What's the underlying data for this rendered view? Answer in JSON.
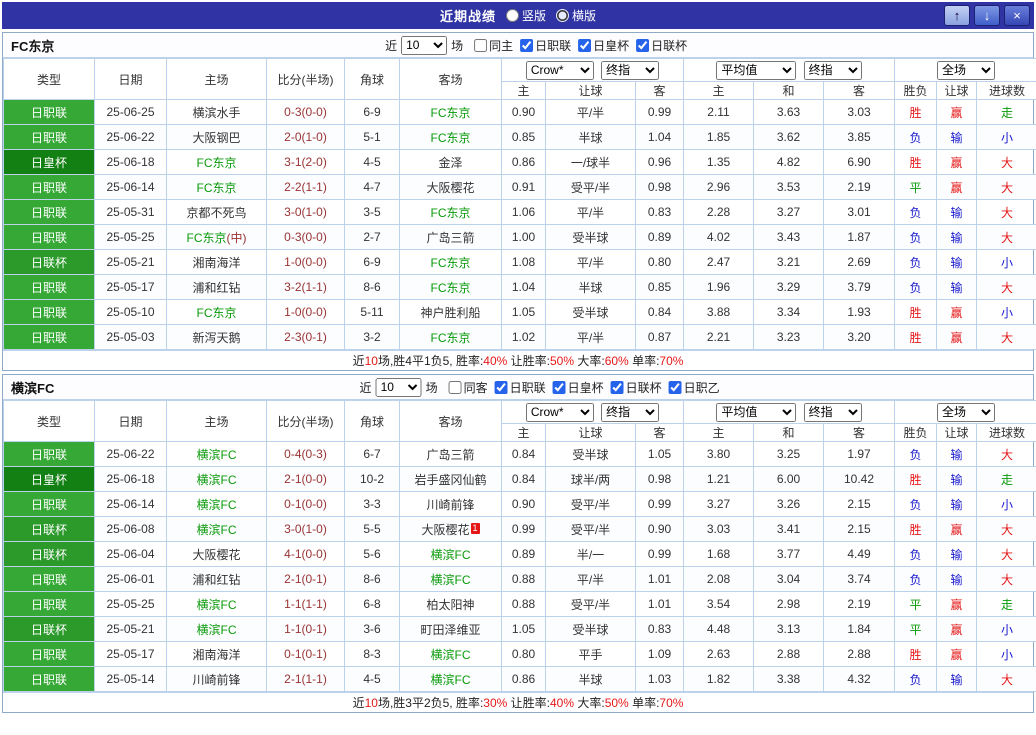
{
  "topbar": {
    "title": "近期战绩",
    "view_options": [
      {
        "label": "竖版",
        "selected": false
      },
      {
        "label": "横版",
        "selected": true
      }
    ],
    "buttons": {
      "up": "↑",
      "down": "↓",
      "close": "×"
    }
  },
  "columns": {
    "type": "类型",
    "date": "日期",
    "home": "主场",
    "score": "比分(半场)",
    "corner": "角球",
    "away": "客场",
    "sub": [
      "主",
      "让球",
      "客",
      "主",
      "和",
      "客",
      "胜负",
      "让球",
      "进球数"
    ]
  },
  "odds_selects": {
    "company": "Crow*",
    "company_time": "终指",
    "avg": "平均值",
    "avg_time": "终指",
    "scope": "全场"
  },
  "league_colors": {
    "日职联": "#35a835",
    "日皇杯": "#128012",
    "日联杯": "#2b9a2b",
    "日职乙": "#2b9a2b"
  },
  "sections": [
    {
      "team": "FC东京",
      "filter": {
        "near_label": "近",
        "count": "10",
        "games_label": "场",
        "checkboxes": [
          {
            "label": "同主",
            "checked": false
          },
          {
            "label": "日职联",
            "checked": true
          },
          {
            "label": "日皇杯",
            "checked": true
          },
          {
            "label": "日联杯",
            "checked": true
          }
        ]
      },
      "rows": [
        {
          "league": "日职联",
          "date": "25-06-25",
          "home": "横滨水手",
          "home_hl": false,
          "score": "0-3(0-0)",
          "corner": "6-9",
          "away": "FC东京",
          "away_hl": true,
          "odds": [
            "0.90",
            "平/半",
            "0.99"
          ],
          "avg": [
            "2.11",
            "3.63",
            "3.03"
          ],
          "wdl": "胜",
          "wdl_c": "w",
          "ah": "赢",
          "ah_c": "w",
          "ou": "走",
          "ou_c": "d"
        },
        {
          "league": "日职联",
          "date": "25-06-22",
          "home": "大阪钢巴",
          "home_hl": false,
          "score": "2-0(1-0)",
          "corner": "5-1",
          "away": "FC东京",
          "away_hl": true,
          "odds": [
            "0.85",
            "半球",
            "1.04"
          ],
          "avg": [
            "1.85",
            "3.62",
            "3.85"
          ],
          "wdl": "负",
          "wdl_c": "l",
          "ah": "输",
          "ah_c": "l",
          "ou": "小",
          "ou_c": "l"
        },
        {
          "league": "日皇杯",
          "date": "25-06-18",
          "home": "FC东京",
          "home_hl": true,
          "score": "3-1(2-0)",
          "corner": "4-5",
          "away": "金泽",
          "away_hl": false,
          "odds": [
            "0.86",
            "一/球半",
            "0.96"
          ],
          "avg": [
            "1.35",
            "4.82",
            "6.90"
          ],
          "wdl": "胜",
          "wdl_c": "w",
          "ah": "赢",
          "ah_c": "w",
          "ou": "大",
          "ou_c": "w"
        },
        {
          "league": "日职联",
          "date": "25-06-14",
          "home": "FC东京",
          "home_hl": true,
          "score": "2-2(1-1)",
          "corner": "4-7",
          "away": "大阪樱花",
          "away_hl": false,
          "odds": [
            "0.91",
            "受平/半",
            "0.98"
          ],
          "avg": [
            "2.96",
            "3.53",
            "2.19"
          ],
          "wdl": "平",
          "wdl_c": "d",
          "ah": "赢",
          "ah_c": "w",
          "ou": "大",
          "ou_c": "w"
        },
        {
          "league": "日职联",
          "date": "25-05-31",
          "home": "京都不死鸟",
          "home_hl": false,
          "score": "3-0(1-0)",
          "corner": "3-5",
          "away": "FC东京",
          "away_hl": true,
          "odds": [
            "1.06",
            "平/半",
            "0.83"
          ],
          "avg": [
            "2.28",
            "3.27",
            "3.01"
          ],
          "wdl": "负",
          "wdl_c": "l",
          "ah": "输",
          "ah_c": "l",
          "ou": "大",
          "ou_c": "w"
        },
        {
          "league": "日职联",
          "date": "25-05-25",
          "home": "FC东京",
          "home_hl": true,
          "home_note": "(中)",
          "score": "0-3(0-0)",
          "corner": "2-7",
          "away": "广岛三箭",
          "away_hl": false,
          "odds": [
            "1.00",
            "受半球",
            "0.89"
          ],
          "avg": [
            "4.02",
            "3.43",
            "1.87"
          ],
          "wdl": "负",
          "wdl_c": "l",
          "ah": "输",
          "ah_c": "l",
          "ou": "大",
          "ou_c": "w"
        },
        {
          "league": "日联杯",
          "date": "25-05-21",
          "home": "湘南海洋",
          "home_hl": false,
          "score": "1-0(0-0)",
          "corner": "6-9",
          "away": "FC东京",
          "away_hl": true,
          "odds": [
            "1.08",
            "平/半",
            "0.80"
          ],
          "avg": [
            "2.47",
            "3.21",
            "2.69"
          ],
          "wdl": "负",
          "wdl_c": "l",
          "ah": "输",
          "ah_c": "l",
          "ou": "小",
          "ou_c": "l"
        },
        {
          "league": "日职联",
          "date": "25-05-17",
          "home": "浦和红钻",
          "home_hl": false,
          "score": "3-2(1-1)",
          "corner": "8-6",
          "away": "FC东京",
          "away_hl": true,
          "odds": [
            "1.04",
            "半球",
            "0.85"
          ],
          "avg": [
            "1.96",
            "3.29",
            "3.79"
          ],
          "wdl": "负",
          "wdl_c": "l",
          "ah": "输",
          "ah_c": "l",
          "ou": "大",
          "ou_c": "w"
        },
        {
          "league": "日职联",
          "date": "25-05-10",
          "home": "FC东京",
          "home_hl": true,
          "score": "1-0(0-0)",
          "corner": "5-11",
          "away": "神户胜利船",
          "away_hl": false,
          "odds": [
            "1.05",
            "受半球",
            "0.84"
          ],
          "avg": [
            "3.88",
            "3.34",
            "1.93"
          ],
          "wdl": "胜",
          "wdl_c": "w",
          "ah": "赢",
          "ah_c": "w",
          "ou": "小",
          "ou_c": "l"
        },
        {
          "league": "日职联",
          "date": "25-05-03",
          "home": "新泻天鹅",
          "home_hl": false,
          "score": "2-3(0-1)",
          "corner": "3-2",
          "away": "FC东京",
          "away_hl": true,
          "odds": [
            "1.02",
            "平/半",
            "0.87"
          ],
          "avg": [
            "2.21",
            "3.23",
            "3.20"
          ],
          "wdl": "胜",
          "wdl_c": "w",
          "ah": "赢",
          "ah_c": "w",
          "ou": "大",
          "ou_c": "w"
        }
      ],
      "footer": [
        {
          "t": "近"
        },
        {
          "t": "10",
          "c": 1
        },
        {
          "t": "场,胜4平1负5, 胜率:"
        },
        {
          "t": "40%",
          "c": 1
        },
        {
          "t": " 让胜率:"
        },
        {
          "t": "50%",
          "c": 1
        },
        {
          "t": " 大率:"
        },
        {
          "t": "60%",
          "c": 1
        },
        {
          "t": " 单率:"
        },
        {
          "t": "70%",
          "c": 1
        }
      ]
    },
    {
      "team": "横滨FC",
      "filter": {
        "near_label": "近",
        "count": "10",
        "games_label": "场",
        "checkboxes": [
          {
            "label": "同客",
            "checked": false
          },
          {
            "label": "日职联",
            "checked": true
          },
          {
            "label": "日皇杯",
            "checked": true
          },
          {
            "label": "日联杯",
            "checked": true
          },
          {
            "label": "日职乙",
            "checked": true
          }
        ]
      },
      "rows": [
        {
          "league": "日职联",
          "date": "25-06-22",
          "home": "横滨FC",
          "home_hl": true,
          "score": "0-4(0-3)",
          "corner": "6-7",
          "away": "广岛三箭",
          "away_hl": false,
          "odds": [
            "0.84",
            "受半球",
            "1.05"
          ],
          "avg": [
            "3.80",
            "3.25",
            "1.97"
          ],
          "wdl": "负",
          "wdl_c": "l",
          "ah": "输",
          "ah_c": "l",
          "ou": "大",
          "ou_c": "w"
        },
        {
          "league": "日皇杯",
          "date": "25-06-18",
          "home": "横滨FC",
          "home_hl": true,
          "score": "2-1(0-0)",
          "corner": "10-2",
          "away": "岩手盛冈仙鹤",
          "away_hl": false,
          "odds": [
            "0.84",
            "球半/两",
            "0.98"
          ],
          "avg": [
            "1.21",
            "6.00",
            "10.42"
          ],
          "wdl": "胜",
          "wdl_c": "w",
          "ah": "输",
          "ah_c": "l",
          "ou": "走",
          "ou_c": "d"
        },
        {
          "league": "日职联",
          "date": "25-06-14",
          "home": "横滨FC",
          "home_hl": true,
          "score": "0-1(0-0)",
          "corner": "3-3",
          "away": "川崎前锋",
          "away_hl": false,
          "odds": [
            "0.90",
            "受平/半",
            "0.99"
          ],
          "avg": [
            "3.27",
            "3.26",
            "2.15"
          ],
          "wdl": "负",
          "wdl_c": "l",
          "ah": "输",
          "ah_c": "l",
          "ou": "小",
          "ou_c": "l"
        },
        {
          "league": "日联杯",
          "date": "25-06-08",
          "home": "横滨FC",
          "home_hl": true,
          "score": "3-0(1-0)",
          "corner": "5-5",
          "away": "大阪樱花",
          "away_hl": false,
          "away_badge": "1",
          "odds": [
            "0.99",
            "受平/半",
            "0.90"
          ],
          "avg": [
            "3.03",
            "3.41",
            "2.15"
          ],
          "wdl": "胜",
          "wdl_c": "w",
          "ah": "赢",
          "ah_c": "w",
          "ou": "大",
          "ou_c": "w"
        },
        {
          "league": "日联杯",
          "date": "25-06-04",
          "home": "大阪樱花",
          "home_hl": false,
          "score": "4-1(0-0)",
          "corner": "5-6",
          "away": "横滨FC",
          "away_hl": true,
          "odds": [
            "0.89",
            "半/一",
            "0.99"
          ],
          "avg": [
            "1.68",
            "3.77",
            "4.49"
          ],
          "wdl": "负",
          "wdl_c": "l",
          "ah": "输",
          "ah_c": "l",
          "ou": "大",
          "ou_c": "w"
        },
        {
          "league": "日职联",
          "date": "25-06-01",
          "home": "浦和红钻",
          "home_hl": false,
          "score": "2-1(0-1)",
          "corner": "8-6",
          "away": "横滨FC",
          "away_hl": true,
          "odds": [
            "0.88",
            "平/半",
            "1.01"
          ],
          "avg": [
            "2.08",
            "3.04",
            "3.74"
          ],
          "wdl": "负",
          "wdl_c": "l",
          "ah": "输",
          "ah_c": "l",
          "ou": "大",
          "ou_c": "w"
        },
        {
          "league": "日职联",
          "date": "25-05-25",
          "home": "横滨FC",
          "home_hl": true,
          "score": "1-1(1-1)",
          "corner": "6-8",
          "away": "柏太阳神",
          "away_hl": false,
          "odds": [
            "0.88",
            "受平/半",
            "1.01"
          ],
          "avg": [
            "3.54",
            "2.98",
            "2.19"
          ],
          "wdl": "平",
          "wdl_c": "d",
          "ah": "赢",
          "ah_c": "w",
          "ou": "走",
          "ou_c": "d"
        },
        {
          "league": "日联杯",
          "date": "25-05-21",
          "home": "横滨FC",
          "home_hl": true,
          "score": "1-1(0-1)",
          "corner": "3-6",
          "away": "町田泽维亚",
          "away_hl": false,
          "odds": [
            "1.05",
            "受半球",
            "0.83"
          ],
          "avg": [
            "4.48",
            "3.13",
            "1.84"
          ],
          "wdl": "平",
          "wdl_c": "d",
          "ah": "赢",
          "ah_c": "w",
          "ou": "小",
          "ou_c": "l"
        },
        {
          "league": "日职联",
          "date": "25-05-17",
          "home": "湘南海洋",
          "home_hl": false,
          "score": "0-1(0-1)",
          "corner": "8-3",
          "away": "横滨FC",
          "away_hl": true,
          "odds": [
            "0.80",
            "平手",
            "1.09"
          ],
          "avg": [
            "2.63",
            "2.88",
            "2.88"
          ],
          "wdl": "胜",
          "wdl_c": "w",
          "ah": "赢",
          "ah_c": "w",
          "ou": "小",
          "ou_c": "l"
        },
        {
          "league": "日职联",
          "date": "25-05-14",
          "home": "川崎前锋",
          "home_hl": false,
          "score": "2-1(1-1)",
          "corner": "4-5",
          "away": "横滨FC",
          "away_hl": true,
          "odds": [
            "0.86",
            "半球",
            "1.03"
          ],
          "avg": [
            "1.82",
            "3.38",
            "4.32"
          ],
          "wdl": "负",
          "wdl_c": "l",
          "ah": "输",
          "ah_c": "l",
          "ou": "大",
          "ou_c": "w"
        }
      ],
      "footer": [
        {
          "t": "近"
        },
        {
          "t": "10",
          "c": 1
        },
        {
          "t": "场,胜3平2负5, 胜率:"
        },
        {
          "t": "30%",
          "c": 1
        },
        {
          "t": " 让胜率:"
        },
        {
          "t": "40%",
          "c": 1
        },
        {
          "t": " 大率:"
        },
        {
          "t": "50%",
          "c": 1
        },
        {
          "t": " 单率:"
        },
        {
          "t": "70%",
          "c": 1
        }
      ]
    }
  ]
}
